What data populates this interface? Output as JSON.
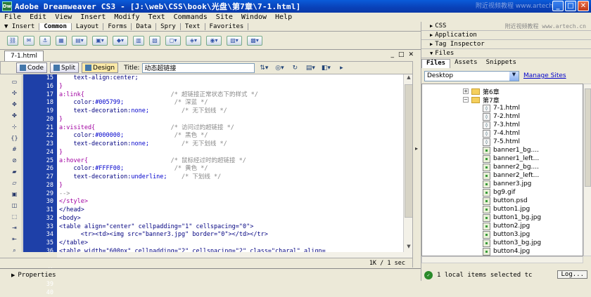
{
  "window": {
    "title": "Adobe Dreamweaver CS3 - [J:\\web\\CSS\\book\\光盘\\第7章\\7-1.html]",
    "watermark": "附近视频教程 www.artech.cn",
    "minimize": "_",
    "maximize": "□",
    "close": "✕",
    "app_icon": "Dw"
  },
  "menu": [
    "File",
    "Edit",
    "View",
    "Insert",
    "Modify",
    "Text",
    "Commands",
    "Site",
    "Window",
    "Help"
  ],
  "insert_bar": {
    "label": "Insert",
    "tabs": [
      "Common",
      "Layout",
      "Forms",
      "Data",
      "Spry",
      "Text",
      "Favorites"
    ],
    "active_tab": "Common"
  },
  "document": {
    "tab": "7-1.html",
    "window_buttons": [
      "_",
      "□",
      "✕"
    ],
    "views": [
      "Code",
      "Split",
      "Design"
    ],
    "active_view": "Design",
    "title_label": "Title:",
    "title_value": "动态超链接"
  },
  "code_lines": [
    {
      "n": "15",
      "segments": [
        {
          "t": "    text-align:center;",
          "c": "navy"
        }
      ]
    },
    {
      "n": "16",
      "segments": [
        {
          "t": "}",
          "c": "purple"
        }
      ]
    },
    {
      "n": "17",
      "segments": [
        {
          "t": "a:link{",
          "c": "purple"
        },
        {
          "t": "                        /* 超链接正常状态下的样式 */",
          "c": "gray"
        }
      ]
    },
    {
      "n": "18",
      "segments": [
        {
          "t": "    color:",
          "c": "navy"
        },
        {
          "t": "#005799;",
          "c": "blue"
        },
        {
          "t": "              /* 深蓝 */",
          "c": "gray"
        }
      ]
    },
    {
      "n": "19",
      "segments": [
        {
          "t": "    text-decoration:",
          "c": "navy"
        },
        {
          "t": "none;",
          "c": "blue"
        },
        {
          "t": "         /* 无下划线 */",
          "c": "gray"
        }
      ]
    },
    {
      "n": "20",
      "segments": [
        {
          "t": "}",
          "c": "purple"
        }
      ]
    },
    {
      "n": "21",
      "segments": [
        {
          "t": "a:visited{",
          "c": "purple"
        },
        {
          "t": "                     /* 访问过的超链接 */",
          "c": "gray"
        }
      ]
    },
    {
      "n": "22",
      "segments": [
        {
          "t": "    color:",
          "c": "navy"
        },
        {
          "t": "#000000;",
          "c": "blue"
        },
        {
          "t": "              /* 黑色 */",
          "c": "gray"
        }
      ]
    },
    {
      "n": "23",
      "segments": [
        {
          "t": "    text-decoration:",
          "c": "navy"
        },
        {
          "t": "none;",
          "c": "blue"
        },
        {
          "t": "         /* 无下划线 */",
          "c": "gray"
        }
      ]
    },
    {
      "n": "24",
      "segments": [
        {
          "t": "}",
          "c": "purple"
        }
      ]
    },
    {
      "n": "25",
      "segments": [
        {
          "t": "a:hover{",
          "c": "purple"
        },
        {
          "t": "                       /* 鼠标经过时的超链接 */",
          "c": "gray"
        }
      ]
    },
    {
      "n": "26",
      "segments": [
        {
          "t": "    color:",
          "c": "navy"
        },
        {
          "t": "#FFFF00;",
          "c": "blue"
        },
        {
          "t": "              /* 黄色 */",
          "c": "gray"
        }
      ]
    },
    {
      "n": "27",
      "segments": [
        {
          "t": "    text-decoration:",
          "c": "navy"
        },
        {
          "t": "underline;",
          "c": "blue"
        },
        {
          "t": "    /* 下划线 */",
          "c": "gray"
        }
      ]
    },
    {
      "n": "28",
      "segments": [
        {
          "t": "}",
          "c": "purple"
        }
      ]
    },
    {
      "n": "29",
      "segments": [
        {
          "t": "-->",
          "c": "gray"
        }
      ]
    },
    {
      "n": "30",
      "segments": [
        {
          "t": "</style>",
          "c": "purple"
        }
      ]
    },
    {
      "n": "31",
      "segments": [
        {
          "t": "</head>",
          "c": "navy"
        }
      ]
    },
    {
      "n": "32",
      "segments": [
        {
          "t": "<body>",
          "c": "navy"
        }
      ]
    },
    {
      "n": "33",
      "segments": [
        {
          "t": "<table align=\"center\" cellpadding=\"1\" cellspacing=\"0\">",
          "c": "navy"
        }
      ]
    },
    {
      "n": "34",
      "segments": [
        {
          "t": "      <tr><td><img src=\"banner3.jpg\" border=\"0\"></td></tr>",
          "c": "navy"
        }
      ]
    },
    {
      "n": "35",
      "segments": [
        {
          "t": "</table>",
          "c": "navy"
        }
      ]
    },
    {
      "n": "36",
      "segments": [
        {
          "t": "<table width=\"600px\" cellpadding=\"2\" cellspacing=\"2\" class=\"charal\" align=",
          "c": "navy"
        }
      ]
    },
    {
      "n": "",
      "segments": [
        {
          "t": "\"center\">",
          "c": "navy"
        }
      ]
    },
    {
      "n": "37",
      "segments": [
        {
          "t": "      <tr>",
          "c": "navy"
        }
      ]
    },
    {
      "n": "38",
      "segments": [
        {
          "t": "          <td><a href=\"#\">首页</a></td>",
          "c": "navy"
        }
      ]
    },
    {
      "n": "39",
      "segments": [
        {
          "t": "          <td><a href=\"#\">心情日记</a></td>",
          "c": "navy"
        }
      ]
    },
    {
      "n": "40",
      "segments": [
        {
          "t": "          <td><a href=\"#\">Free</a></td>",
          "c": "navy"
        }
      ]
    }
  ],
  "status": {
    "size_time": "1K / 1 sec"
  },
  "properties": {
    "label": "Properties"
  },
  "panels": {
    "css": "CSS",
    "application": "Application",
    "tag_inspector": "Tag Inspector",
    "files": "Files",
    "watermark": "附近视频教程 www.artech.cn"
  },
  "files_tabs": [
    "Files",
    "Assets",
    "Snippets"
  ],
  "files_active_tab": "Files",
  "site_select": "Desktop",
  "manage_sites": "Manage Sites",
  "tree": [
    {
      "name": "第6章",
      "kind": "folder",
      "indent": 1,
      "exp": "+"
    },
    {
      "name": "第7章",
      "kind": "folder",
      "indent": 1,
      "exp": "−"
    },
    {
      "name": "7-1.html",
      "kind": "html",
      "indent": 2
    },
    {
      "name": "7-2.html",
      "kind": "html",
      "indent": 2
    },
    {
      "name": "7-3.html",
      "kind": "html",
      "indent": 2
    },
    {
      "name": "7-4.html",
      "kind": "html",
      "indent": 2
    },
    {
      "name": "7-5.html",
      "kind": "html",
      "indent": 2
    },
    {
      "name": "banner1_bg....",
      "kind": "img",
      "indent": 2
    },
    {
      "name": "banner1_left...",
      "kind": "img",
      "indent": 2
    },
    {
      "name": "banner2_bg....",
      "kind": "img",
      "indent": 2
    },
    {
      "name": "banner2_left...",
      "kind": "img",
      "indent": 2
    },
    {
      "name": "banner3.jpg",
      "kind": "img",
      "indent": 2
    },
    {
      "name": "bg9.gif",
      "kind": "img",
      "indent": 2
    },
    {
      "name": "button.psd",
      "kind": "img",
      "indent": 2
    },
    {
      "name": "button1.jpg",
      "kind": "img",
      "indent": 2
    },
    {
      "name": "button1_bg.jpg",
      "kind": "img",
      "indent": 2
    },
    {
      "name": "button2.jpg",
      "kind": "img",
      "indent": 2
    },
    {
      "name": "button3.jpg",
      "kind": "img",
      "indent": 2
    },
    {
      "name": "button3_bg.jpg",
      "kind": "img",
      "indent": 2
    },
    {
      "name": "button4.jpg",
      "kind": "img",
      "indent": 2
    }
  ],
  "file_status": "1 local items selected tc",
  "log_button": "Log..."
}
